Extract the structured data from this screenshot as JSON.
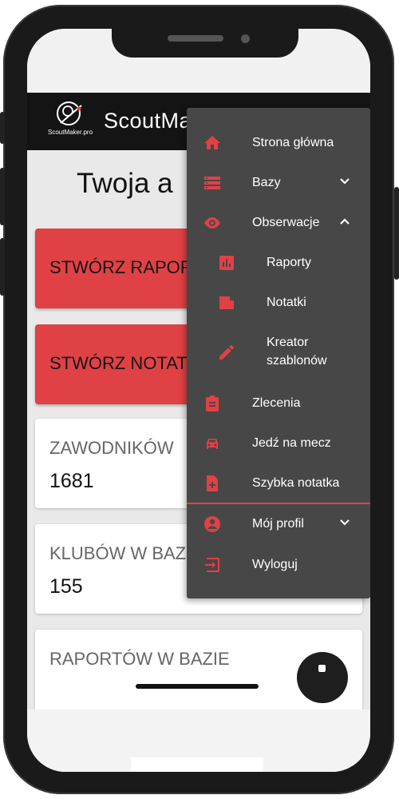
{
  "app": {
    "title": "ScoutMa",
    "logo_text": "ScoutMaker.pro"
  },
  "page": {
    "heading": "Twoja a"
  },
  "actions": [
    {
      "label": "STWÓRZ RAPOR"
    },
    {
      "label": "STWÓRZ NOTAT"
    }
  ],
  "stats": [
    {
      "label": "ZAWODNIKÓW",
      "value": "1681"
    },
    {
      "label": "KLUBÓW W BAZ",
      "value": "155"
    },
    {
      "label": "RAPORTÓW W BAZIE",
      "value": ""
    }
  ],
  "menu": {
    "items": [
      {
        "label": "Strona główna",
        "icon": "home-icon"
      },
      {
        "label": "Bazy",
        "icon": "database-icon",
        "chevron": "chevron-down-icon"
      },
      {
        "label": "Obserwacje",
        "icon": "eye-icon",
        "chevron": "chevron-up-icon"
      },
      {
        "label": "Raporty",
        "icon": "chart-icon"
      },
      {
        "label": "Notatki",
        "icon": "note-icon"
      },
      {
        "label_line1": "Kreator",
        "label_line2": "szablonów",
        "icon": "pencil-icon"
      },
      {
        "label": "Zlecenia",
        "icon": "clipboard-icon"
      },
      {
        "label": "Jedź na mecz",
        "icon": "car-icon"
      },
      {
        "label": "Szybka notatka",
        "icon": "note-add-icon"
      },
      {
        "label": "Mój profil",
        "icon": "account-icon",
        "chevron": "chevron-down-icon"
      },
      {
        "label": "Wyloguj",
        "icon": "logout-icon"
      }
    ]
  },
  "colors": {
    "accent": "#e04145",
    "menu_bg": "#474747",
    "appbar": "#141414"
  }
}
